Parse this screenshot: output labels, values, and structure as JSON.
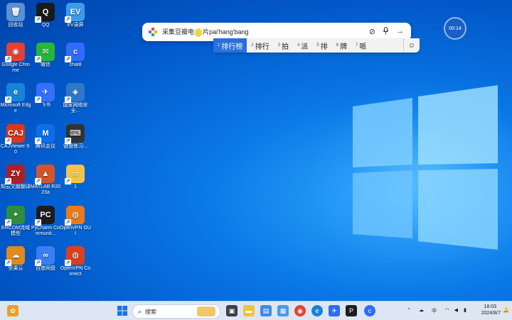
{
  "desktop": {
    "icons": [
      {
        "label": "回收站",
        "badge": "🗑",
        "color": "#5b8fd6"
      },
      {
        "label": "QQ",
        "badge": "Q",
        "color": "#1a1a1a"
      },
      {
        "label": "EV录屏",
        "badge": "EV",
        "color": "#3d9be9"
      },
      {
        "label": "Google Chrome",
        "badge": "◉",
        "color": "#e34133"
      },
      {
        "label": "微信",
        "badge": "✉",
        "color": "#25b63a"
      },
      {
        "label": "chat8",
        "badge": "c",
        "color": "#2f6bff"
      },
      {
        "label": "Microsoft Edge",
        "badge": "e",
        "color": "#1784d8"
      },
      {
        "label": "飞书",
        "badge": "✈",
        "color": "#3370ff"
      },
      {
        "label": "国家网络安全...",
        "badge": "◈",
        "color": "#2d78c8"
      },
      {
        "label": "CAJViewer 9.0",
        "badge": "CAJ",
        "color": "#d9381e"
      },
      {
        "label": "腾讯会议",
        "badge": "M",
        "color": "#0a6fe8"
      },
      {
        "label": "键盘练习...",
        "badge": "⌨",
        "color": "#333333"
      },
      {
        "label": "知云文献翻译",
        "badge": "ZY",
        "color": "#b01e23"
      },
      {
        "label": "MATLAB R2023a",
        "badge": "▲",
        "color": "#d3542a"
      },
      {
        "label": "1",
        "badge": "▭",
        "color": "#f3c34b"
      },
      {
        "label": "ERCOM流域模型",
        "badge": "✦",
        "color": "#2f8d3b"
      },
      {
        "label": "PyCharm Communit...",
        "badge": "PC",
        "color": "#1d1d1d"
      },
      {
        "label": "OpenVPN GUI",
        "badge": "◍",
        "color": "#ea7a1a"
      },
      {
        "label": "坚果云",
        "badge": "☁",
        "color": "#e08a20"
      },
      {
        "label": "百度网盘",
        "badge": "∞",
        "color": "#3a7ff2"
      },
      {
        "label": "OpenVPN Connect",
        "badge": "◍",
        "color": "#d9411e"
      }
    ]
  },
  "ime": {
    "composition_before": "采集豆瓣电",
    "composition_after": "片pai'hang'bang",
    "candidates": [
      {
        "num": "1",
        "text": "排行榜",
        "selected": true
      },
      {
        "num": "2",
        "text": "排行",
        "selected": false
      },
      {
        "num": "3",
        "text": "拍",
        "selected": false
      },
      {
        "num": "4",
        "text": "派",
        "selected": false
      },
      {
        "num": "5",
        "text": "排",
        "selected": false
      },
      {
        "num": "6",
        "text": "牌",
        "selected": false
      },
      {
        "num": "7",
        "text": "哌",
        "selected": false
      }
    ],
    "emoji_glyph": "☺",
    "tools": {
      "attach": "⊘",
      "mic": "🎤",
      "submit": "→"
    }
  },
  "timer": {
    "value": "00:14"
  },
  "taskbar": {
    "search_placeholder": "搜索",
    "tray": {
      "chevron": "⌃",
      "cloud": "☁",
      "lang": "中",
      "wifi": "◠",
      "volume": "◀",
      "battery": "▮",
      "time": "18:03",
      "date": "2024/8/7",
      "bell": "🔔"
    }
  }
}
